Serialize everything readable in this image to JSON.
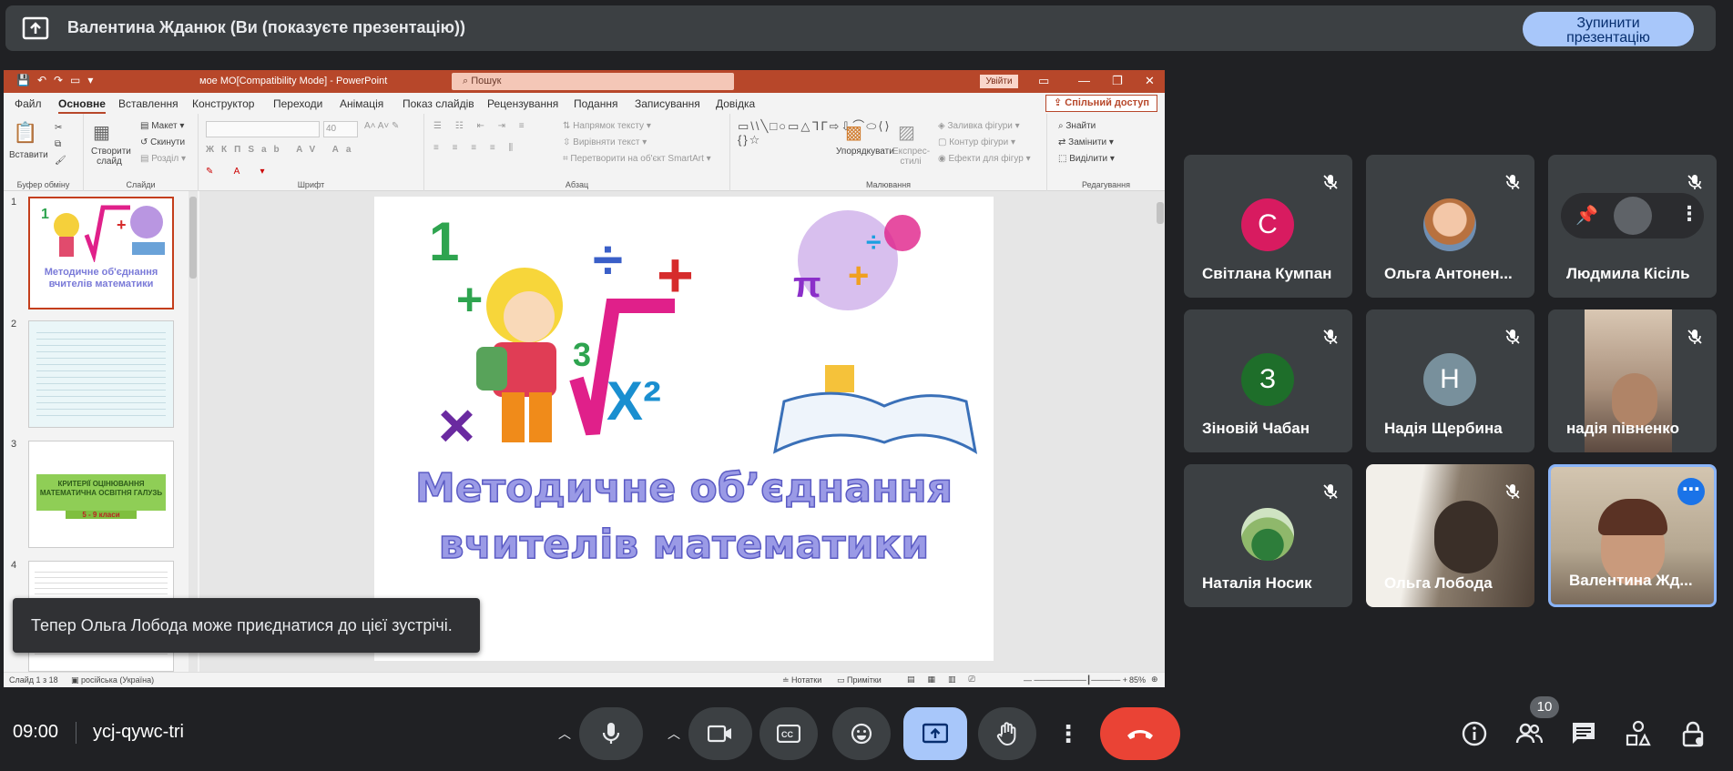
{
  "topbar": {
    "title": "Валентина Жданюк (Ви (показуєте презентацію))",
    "stop_label": "Зупинити\nпрезентацію"
  },
  "ppt": {
    "doc_title": "мое МО[Compatibility Mode]  -  PowerPoint",
    "search_placeholder": "Пошук",
    "signin_label": "Увійти",
    "menu": [
      "Файл",
      "Основне",
      "Вставлення",
      "Конструктор",
      "Переходи",
      "Анімація",
      "Показ слайдів",
      "Рецензування",
      "Подання",
      "Записування",
      "Довідка"
    ],
    "share_label": "Спільний доступ",
    "ribbon": {
      "paste": "Вставити",
      "clipboard_group": "Буфер обміну",
      "new_slide": "Створити слайд",
      "layout": "Макет",
      "reset": "Скинути",
      "section": "Розділ",
      "slides_group": "Слайди",
      "font_size": "40",
      "font_group": "Шрифт",
      "text_direction": "Напрямок тексту",
      "align_text": "Вирівняти текст",
      "smartart": "Перетворити на об'єкт SmartArt",
      "paragraph_group": "Абзац",
      "arrange": "Упорядкувати",
      "quick_styles": "Експрес-стилі",
      "fill": "Заливка фігури",
      "outline": "Контур фігури",
      "effects": "Ефекти для фігур",
      "drawing_group": "Малювання",
      "find": "Знайти",
      "replace": "Замінити",
      "select": "Виділити",
      "editing_group": "Редагування"
    },
    "thumbs": [
      {
        "num": "1",
        "title": "Методичне об'єднання вчителів математики"
      },
      {
        "num": "2"
      },
      {
        "num": "3",
        "title": "КРИТЕРІЇ ОЦІНЮВАННЯ МАТЕМАТИЧНА ОСВІТНЯ ГАЛУЗЬ",
        "sub": "5 - 9 класи"
      },
      {
        "num": "4"
      }
    ],
    "slide_title_line1": "Методичне об’єднання",
    "slide_title_line2": "вчителів математики",
    "status": {
      "slide_of": "Слайд 1 з 18",
      "language": "російська (Україна)",
      "notes": "Нотатки",
      "comments": "Примітки",
      "zoom": "85%"
    }
  },
  "toast": "Тепер Ольга Лобода може приєднатися до цієї зустрічі.",
  "participants": [
    {
      "name": "Світлана Кумпан",
      "initial": "С",
      "color": "#d81b60"
    },
    {
      "name": "Ольга Антонен...",
      "initial": "",
      "color": ""
    },
    {
      "name": "Людмила Кісіль",
      "initial": "",
      "color": ""
    },
    {
      "name": "Зіновій Чабан",
      "initial": "З",
      "color": "#1e6e2a"
    },
    {
      "name": "Надія Щербина",
      "initial": "Н",
      "color": "#78909c"
    },
    {
      "name": "надія півненко",
      "initial": "",
      "color": ""
    },
    {
      "name": "Наталія Носик",
      "initial": "",
      "color": ""
    },
    {
      "name": "Ольга Лобода",
      "initial": "",
      "color": ""
    },
    {
      "name": "Валентина Жд...",
      "initial": "",
      "color": ""
    }
  ],
  "bottom": {
    "time": "09:00",
    "meeting_code": "ycj-qywc-tri",
    "participants_count": "10"
  },
  "colors": {
    "accent": "#a8c7fa",
    "leave": "#ea4335",
    "ppt_brand": "#b7472a"
  }
}
